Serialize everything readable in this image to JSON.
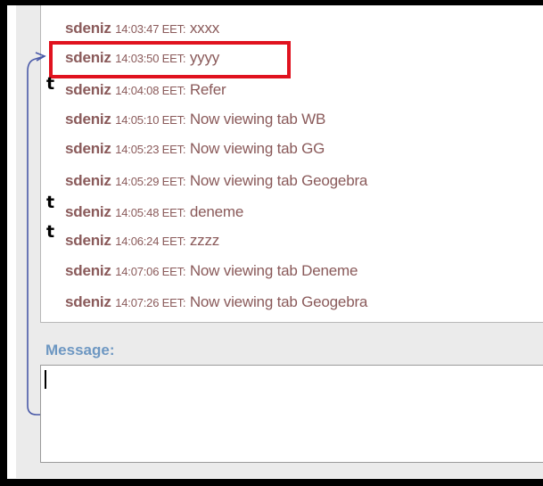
{
  "chat": {
    "lines": [
      {
        "user": "sdeniz",
        "time": "14:03:47 EET:",
        "text": "xxxx"
      },
      {
        "user": "sdeniz",
        "time": "14:03:50 EET:",
        "text": "yyyy"
      },
      {
        "user": "sdeniz",
        "time": "14:04:08 EET:",
        "text": "Refer"
      },
      {
        "user": "sdeniz",
        "time": "14:05:10 EET:",
        "text": "Now viewing tab WB"
      },
      {
        "user": "sdeniz",
        "time": "14:05:23 EET:",
        "text": "Now viewing tab GG"
      },
      {
        "user": "sdeniz",
        "time": "14:05:29 EET:",
        "text": "Now viewing tab Geogebra"
      },
      {
        "user": "sdeniz",
        "time": "14:05:48 EET:",
        "text": "deneme"
      },
      {
        "user": "sdeniz",
        "time": "14:06:24 EET:",
        "text": "zzzz"
      },
      {
        "user": "sdeniz",
        "time": "14:07:06 EET:",
        "text": "Now viewing tab Deneme"
      },
      {
        "user": "sdeniz",
        "time": "14:07:26 EET:",
        "text": "Now viewing tab Geogebra"
      }
    ],
    "highlighted_index": 1
  },
  "composer": {
    "label": "Message:",
    "value": ""
  },
  "annotations": {
    "marks": [
      "t",
      "t",
      "t"
    ]
  },
  "colors": {
    "chat_text": "#8a5a5a",
    "label": "#6d97c2",
    "highlight": "#e0121f",
    "bracket": "#4a5aa8"
  }
}
